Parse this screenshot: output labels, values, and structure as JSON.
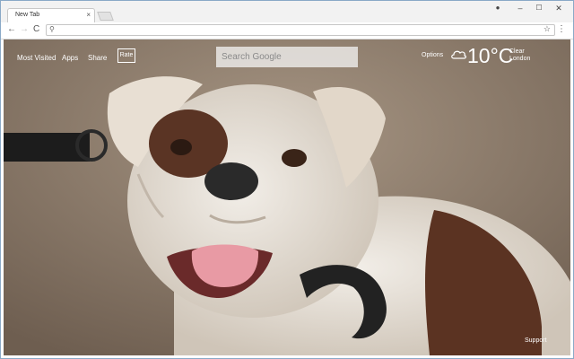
{
  "browser": {
    "tab_title": "New Tab",
    "tab_close": "×",
    "window_controls": {
      "profile": "●",
      "minimize": "–",
      "maximize": "☐",
      "close": "✕"
    },
    "nav": {
      "back": "←",
      "forward": "→",
      "reload": "C"
    },
    "address_value": "",
    "menu": "⋮",
    "star": "☆"
  },
  "page": {
    "nav_items": [
      "Most Visited",
      "Apps",
      "Share"
    ],
    "rate_label": "Rate",
    "search_placeholder": "Search Google",
    "options_label": "Options",
    "weather": {
      "temperature": "10°C",
      "condition": "Clear",
      "location": "London",
      "icon": "cloud-icon"
    },
    "support_label": "Support"
  }
}
